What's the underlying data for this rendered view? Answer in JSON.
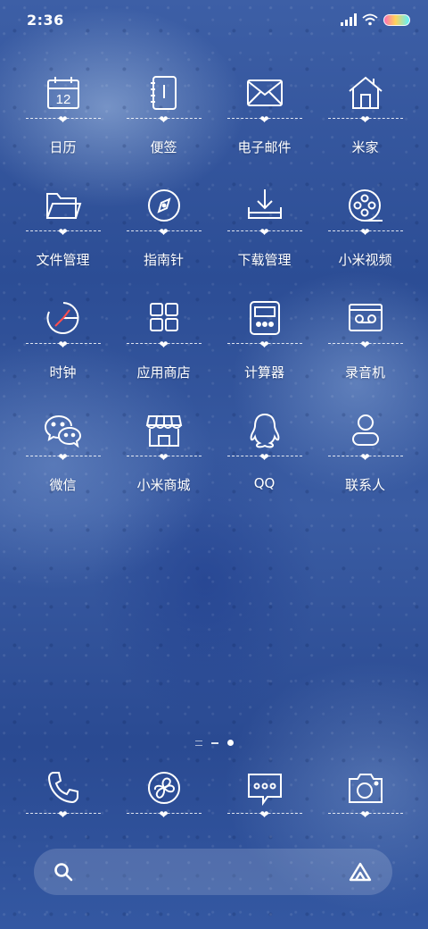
{
  "status_bar": {
    "time": "2:36"
  },
  "apps": [
    {
      "label": "日历",
      "icon": "calendar-icon",
      "calendar_day": "12"
    },
    {
      "label": "便签",
      "icon": "notes-icon"
    },
    {
      "label": "电子邮件",
      "icon": "mail-icon"
    },
    {
      "label": "米家",
      "icon": "home-icon"
    },
    {
      "label": "文件管理",
      "icon": "folder-icon"
    },
    {
      "label": "指南针",
      "icon": "compass-icon"
    },
    {
      "label": "下载管理",
      "icon": "download-icon"
    },
    {
      "label": "小米视频",
      "icon": "film-reel-icon"
    },
    {
      "label": "时钟",
      "icon": "clock-icon"
    },
    {
      "label": "应用商店",
      "icon": "app-store-icon"
    },
    {
      "label": "计算器",
      "icon": "calculator-icon"
    },
    {
      "label": "录音机",
      "icon": "recorder-icon"
    },
    {
      "label": "微信",
      "icon": "wechat-icon"
    },
    {
      "label": "小米商城",
      "icon": "shop-icon"
    },
    {
      "label": "QQ",
      "icon": "qq-icon"
    },
    {
      "label": "联系人",
      "icon": "contacts-icon"
    }
  ],
  "dock": [
    {
      "icon": "phone-icon"
    },
    {
      "icon": "browser-icon"
    },
    {
      "icon": "messages-icon"
    },
    {
      "icon": "camera-icon"
    }
  ],
  "decoration": {
    "heart": "❤"
  },
  "theme": {
    "icon_color": "#ffffff",
    "clock_hand_color": "#ff4d4d"
  }
}
